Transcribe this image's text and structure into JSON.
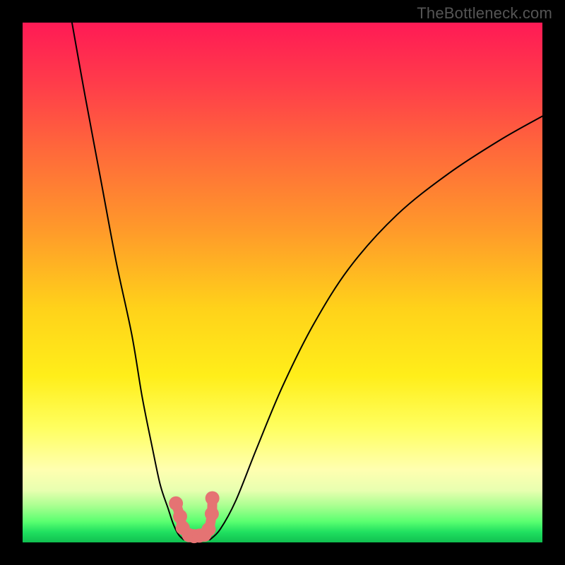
{
  "watermark": "TheBottleneck.com",
  "chart_data": {
    "type": "line",
    "title": "",
    "xlabel": "",
    "ylabel": "",
    "xlim": [
      0,
      100
    ],
    "ylim": [
      0,
      100
    ],
    "series": [
      {
        "name": "left-curve",
        "x": [
          9.5,
          12,
          15,
          18,
          21,
          23,
          25,
          26.5,
          28,
          29,
          30,
          31
        ],
        "values": [
          100,
          86,
          70,
          54,
          40,
          28,
          18,
          11,
          6.5,
          3.5,
          1.5,
          0.5
        ]
      },
      {
        "name": "right-curve",
        "x": [
          36,
          38,
          41,
          45,
          50,
          56,
          63,
          72,
          82,
          92,
          100
        ],
        "values": [
          0.5,
          2.5,
          8,
          18,
          30,
          42,
          53,
          63,
          71,
          77.5,
          82
        ]
      }
    ],
    "markers": {
      "name": "dotted-valley",
      "x": [
        29.5,
        30.3,
        30.8,
        32.0,
        33.0,
        34.0,
        35.0,
        35.8,
        36.4,
        36.5
      ],
      "values": [
        7.5,
        5.0,
        2.8,
        1.4,
        1.2,
        1.3,
        1.5,
        2.5,
        5.5,
        8.5
      ]
    },
    "colors": {
      "background_gradient_top": "#ff1a55",
      "background_gradient_bottom": "#10c050",
      "curve": "#000000",
      "markers": "#e57373",
      "frame": "#000000"
    }
  }
}
